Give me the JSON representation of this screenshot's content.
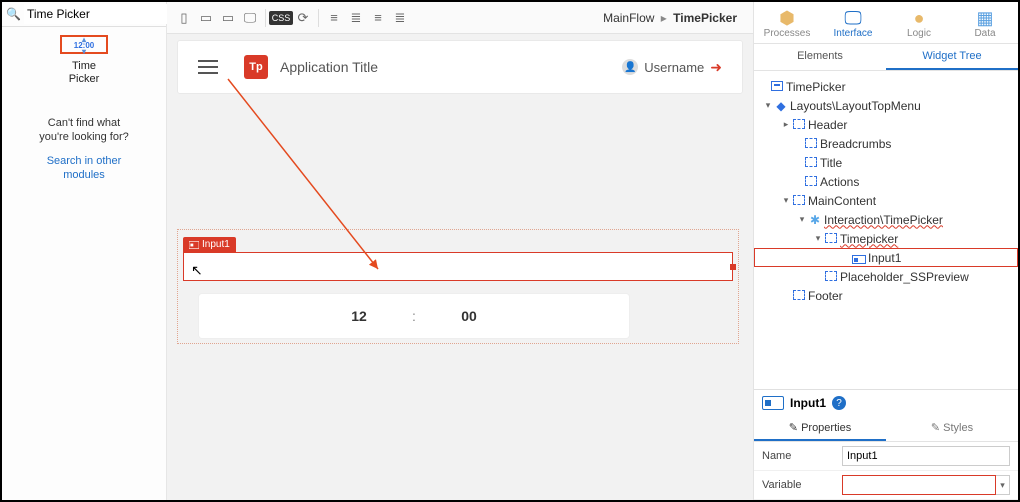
{
  "search": {
    "value": "Time Picker"
  },
  "widget": {
    "badge": "12:00",
    "label_l1": "Time",
    "label_l2": "Picker"
  },
  "sidebar": {
    "cantfind_l1": "Can't find what",
    "cantfind_l2": "you're looking for?",
    "searchother_l1": "Search in other",
    "searchother_l2": "modules"
  },
  "breadcrumb": {
    "a": "MainFlow",
    "b": "TimePicker"
  },
  "appbar": {
    "title": "Application Title",
    "username": "Username"
  },
  "selection": {
    "label": "Input1"
  },
  "picker": {
    "hour": "12",
    "minute": "00"
  },
  "cats": {
    "processes": "Processes",
    "interface": "Interface",
    "logic": "Logic",
    "data": "Data"
  },
  "subtabs": {
    "elements": "Elements",
    "widgettree": "Widget Tree"
  },
  "tree": {
    "root": "TimePicker",
    "layouts": "Layouts\\LayoutTopMenu",
    "header": "Header",
    "breadcrumbs": "Breadcrumbs",
    "title": "Title",
    "actions": "Actions",
    "maincontent": "MainContent",
    "interaction": "Interaction\\TimePicker",
    "timepicker": "Timepicker",
    "input1": "Input1",
    "placeholder": "Placeholder_SSPreview",
    "footer": "Footer"
  },
  "propheader": {
    "title": "Input1"
  },
  "modetabs": {
    "properties": "Properties",
    "styles": "Styles"
  },
  "proprows": {
    "name_k": "Name",
    "name_v": "Input1",
    "var_k": "Variable",
    "var_v": ""
  },
  "css_label": "CSS"
}
